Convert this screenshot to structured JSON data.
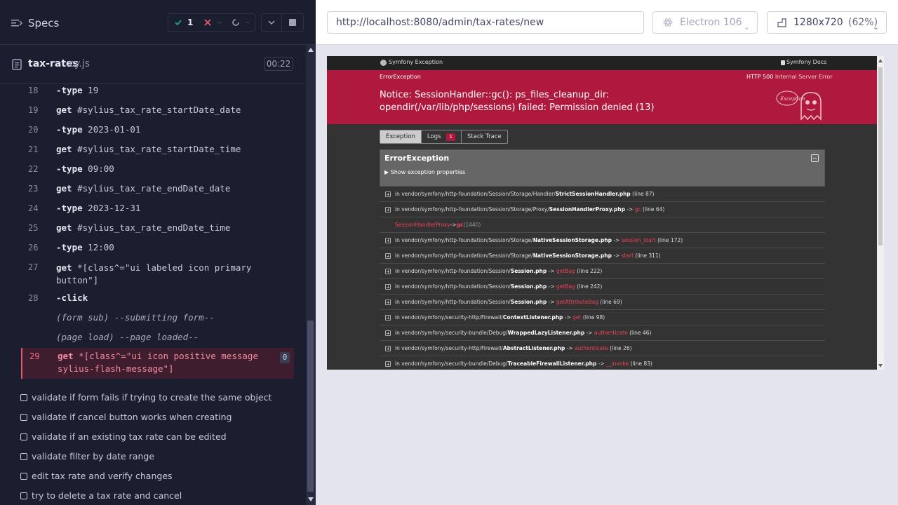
{
  "reporter": {
    "title": "Specs",
    "passed_count": "1",
    "failed_count": "--",
    "pending_count": "--",
    "file_name": "tax-rates",
    "file_ext": ".cy.js",
    "duration": "00:22"
  },
  "commands": [
    {
      "line": "18",
      "name": "-type",
      "msg": "19"
    },
    {
      "line": "19",
      "name": "get",
      "msg": "#sylius_tax_rate_startDate_date"
    },
    {
      "line": "20",
      "name": "-type",
      "msg": "2023-01-01"
    },
    {
      "line": "21",
      "name": "get",
      "msg": "#sylius_tax_rate_startDate_time"
    },
    {
      "line": "22",
      "name": "-type",
      "msg": "09:00"
    },
    {
      "line": "23",
      "name": "get",
      "msg": "#sylius_tax_rate_endDate_date"
    },
    {
      "line": "24",
      "name": "-type",
      "msg": "2023-12-31"
    },
    {
      "line": "25",
      "name": "get",
      "msg": "#sylius_tax_rate_endDate_time"
    },
    {
      "line": "26",
      "name": "-type",
      "msg": "12:00"
    },
    {
      "line": "27",
      "name": "get",
      "msg": "*[class^=\"ui labeled icon primary button\"]"
    },
    {
      "line": "28",
      "name": "-click",
      "msg": ""
    },
    {
      "line": "",
      "name": "(form sub)",
      "msg": "--submitting form--"
    },
    {
      "line": "",
      "name": "(page load)",
      "msg": "--page loaded--"
    },
    {
      "line": "29",
      "name": "get",
      "msg": "*[class^=\"ui icon positive message sylius-flash-message\"]",
      "badge": "0"
    }
  ],
  "tests": [
    "validate if form fails if trying to create the same object",
    "validate if cancel button works when creating",
    "validate if an existing tax rate can be edited",
    "validate filter by date range",
    "edit tax rate and verify changes",
    "try to delete a tax rate and cancel"
  ],
  "browser_bar": {
    "url": "http://localhost:8080/admin/tax-rates/new",
    "browser": "Electron 106",
    "viewport": "1280x720",
    "zoom": "(62%)"
  },
  "symfony": {
    "header_title": "Symfony Exception",
    "docs": "Symfony Docs",
    "exception_class": "ErrorException",
    "http_code": "HTTP 500",
    "http_status": "Internal Server Error",
    "message": "Notice: SessionHandler::gc(): ps_files_cleanup_dir: opendir(/var/lib/php/sessions) failed: Permission denied (13)",
    "tabs": [
      {
        "label": "Exception"
      },
      {
        "label": "Logs",
        "badge": "1"
      },
      {
        "label": "Stack Trace"
      }
    ],
    "panel_title": "ErrorException",
    "toggle": "▶ Show exception properties",
    "trace": [
      {
        "pre": "in vendor/symfony/http-foundation/Session/Storage/Handler/",
        "file": "StrictSessionHandler.php",
        "fn": "",
        "line": "(line 87)"
      },
      {
        "pre": "in vendor/symfony/http-foundation/Session/Storage/Proxy/",
        "file": "SessionHandlerProxy.php",
        "fn": "gc",
        "line": "(line 64)"
      },
      {
        "sub": true,
        "cls": "SessionHandlerProxy",
        "fn": "gc",
        "line": "(1440)"
      },
      {
        "pre": "in vendor/symfony/http-foundation/Session/Storage/",
        "file": "NativeSessionStorage.php",
        "fn": "session_start",
        "line": "(line 172)"
      },
      {
        "pre": "in vendor/symfony/http-foundation/Session/Storage/",
        "file": "NativeSessionStorage.php",
        "fn": "start",
        "line": "(line 311)"
      },
      {
        "pre": "in vendor/symfony/http-foundation/Session/",
        "file": "Session.php",
        "fn": "getBag",
        "line": "(line 222)"
      },
      {
        "pre": "in vendor/symfony/http-foundation/Session/",
        "file": "Session.php",
        "fn": "getBag",
        "line": "(line 242)"
      },
      {
        "pre": "in vendor/symfony/http-foundation/Session/",
        "file": "Session.php",
        "fn": "getAttributeBag",
        "line": "(line 69)"
      },
      {
        "pre": "in vendor/symfony/security-http/Firewall/",
        "file": "ContextListener.php",
        "fn": "get",
        "line": "(line 98)"
      },
      {
        "pre": "in vendor/symfony/security-bundle/Debug/",
        "file": "WrappedLazyListener.php",
        "fn": "authenticate",
        "line": "(line 46)"
      },
      {
        "pre": "in vendor/symfony/security-http/Firewall/",
        "file": "AbstractListener.php",
        "fn": "authenticate",
        "line": "(line 26)"
      },
      {
        "pre": "in vendor/symfony/security-bundle/Debug/",
        "file": "TraceableFirewallListener.php",
        "fn": "__invoke",
        "line": "(line 83)"
      }
    ]
  },
  "colors": {
    "passed": "#1fa971",
    "failed": "#e45770",
    "pending": "#a0a3b8",
    "symfony_red": "#b0193e"
  }
}
